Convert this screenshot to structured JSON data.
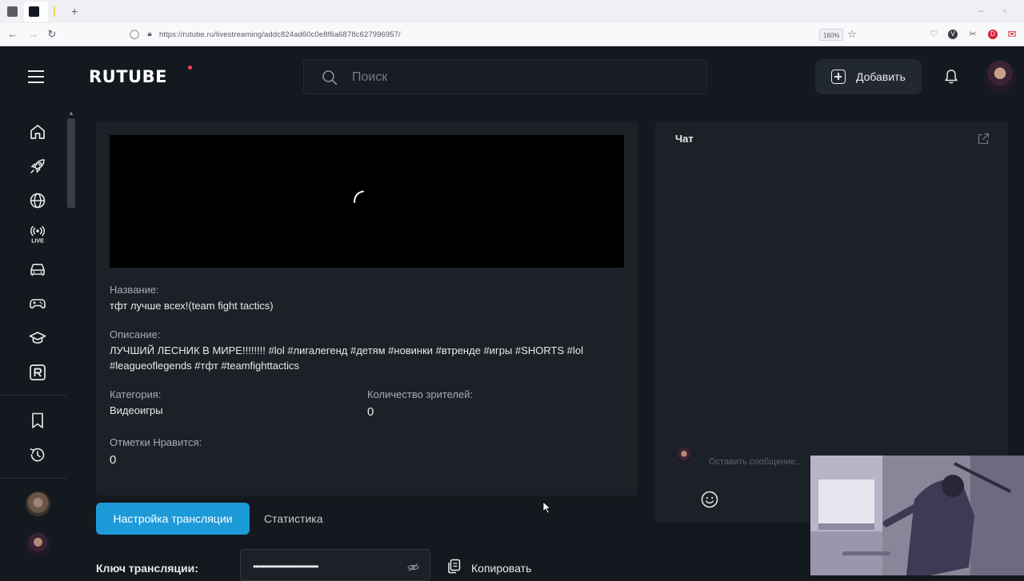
{
  "browser": {
    "url": "https://rutube.ru/livestreaming/addc824ad60c0e8f6a6878c627996957/",
    "zoom": "160%"
  },
  "header": {
    "logo": "RUTUBE",
    "search_placeholder": "Поиск",
    "add_label": "Добавить"
  },
  "sidebar": {
    "items": [
      "home-icon",
      "rocket-icon",
      "globe-icon",
      "live-icon",
      "car-icon",
      "gamepad-icon",
      "graduation-cap-icon",
      "rutube-r-icon",
      "bookmark-icon",
      "history-icon"
    ]
  },
  "stream": {
    "name_label": "Название:",
    "name_value": "тфт лучше всех!(team fight tactics)",
    "desc_label": "Описание:",
    "desc_value": "ЛУЧШИЙ ЛЕСНИК В МИРЕ!!!!!!!! #lol #лигалегенд #детям #новинки #втренде #игры #SHORTS #lol #leagueoflegends #тфт #teamfighttactics",
    "category_label": "Категория:",
    "category_value": "Видеоигры",
    "viewers_label": "Количество зрителей:",
    "viewers_value": "0",
    "likes_label": "Отметки Нравится:",
    "likes_value": "0"
  },
  "tabs": {
    "settings": "Настройка трансляции",
    "stats": "Статистика"
  },
  "key": {
    "label": "Ключ трансляции:",
    "masked": "••••••••••••••••••••••••••••••",
    "copy_label": "Копировать"
  },
  "chat": {
    "title": "Чат",
    "placeholder": "Оставить сообщение..."
  },
  "colors": {
    "accent": "#1d9ad8",
    "background": "#14191f",
    "panel": "#1c2128",
    "logo_dot": "#ff3b5c"
  }
}
